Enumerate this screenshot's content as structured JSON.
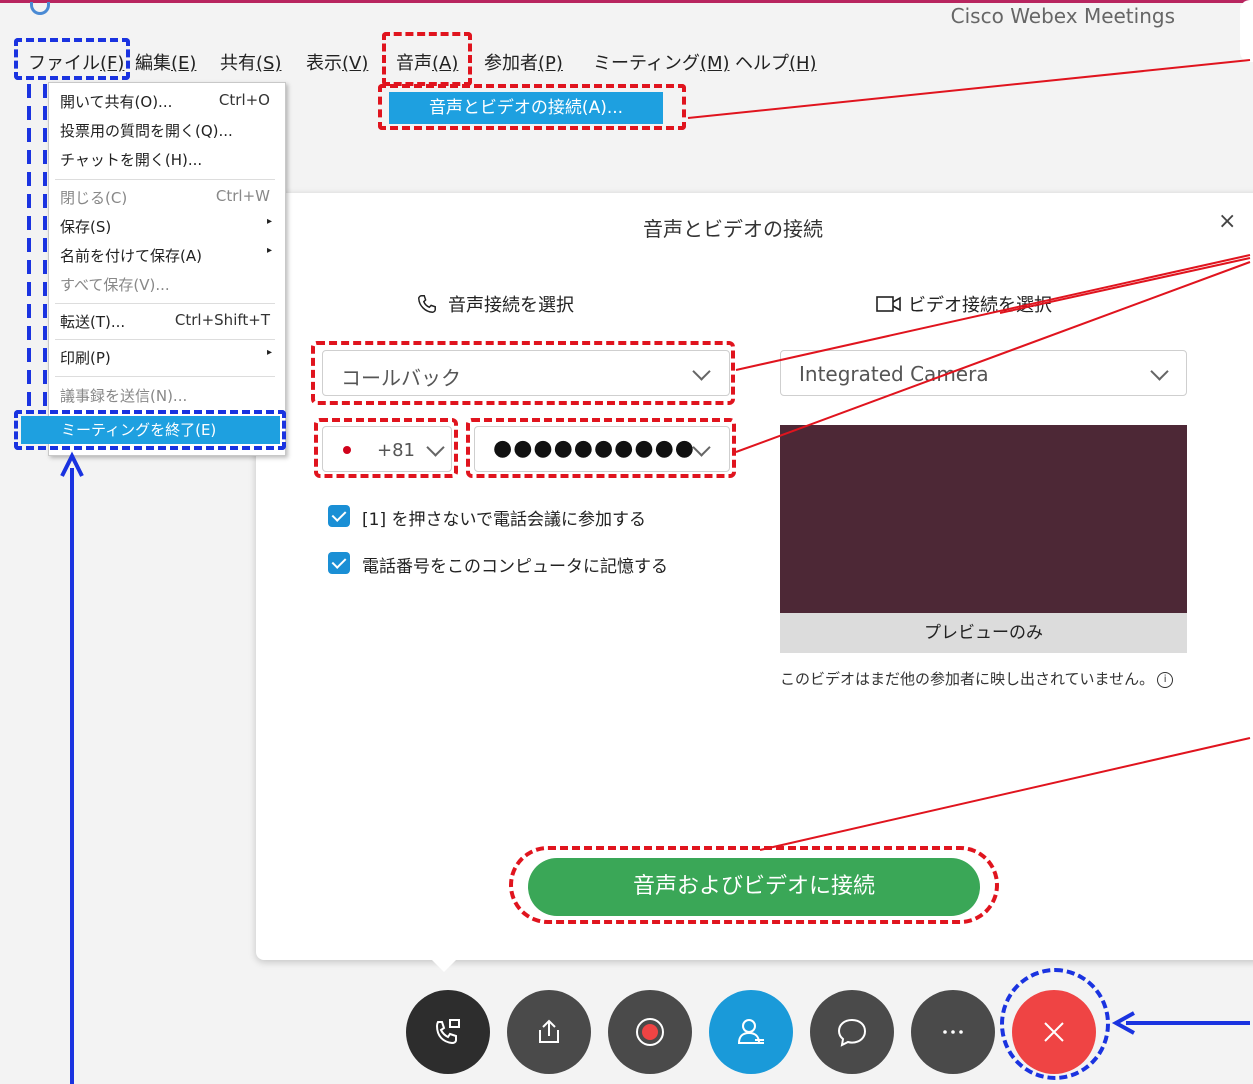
{
  "window": {
    "title": "Cisco Webex Meetings"
  },
  "menubar": {
    "items": [
      {
        "label": "ファイル",
        "accel": "(F)"
      },
      {
        "label": "編集",
        "accel": "(E)"
      },
      {
        "label": "共有",
        "accel": "(S)"
      },
      {
        "label": "表示",
        "accel": "(V)"
      },
      {
        "label": "音声",
        "accel": "(A)"
      },
      {
        "label": "参加者",
        "accel": "(P)"
      },
      {
        "label": "ミーティング",
        "accel": "(M)"
      },
      {
        "label": "ヘルプ",
        "accel": "(H)"
      }
    ]
  },
  "file_menu": {
    "items": [
      {
        "label": "開いて共有(O)...",
        "shortcut": "Ctrl+O"
      },
      {
        "label": "投票用の質問を開く(Q)...",
        "shortcut": ""
      },
      {
        "label": "チャットを開く(H)...",
        "shortcut": ""
      },
      {
        "label": "閉じる(C)",
        "shortcut": "Ctrl+W"
      },
      {
        "label": "保存(S)",
        "shortcut": ""
      },
      {
        "label": "名前を付けて保存(A)",
        "shortcut": ""
      },
      {
        "label": "すべて保存(V)...",
        "shortcut": ""
      },
      {
        "label": "転送(T)...",
        "shortcut": "Ctrl+Shift+T"
      },
      {
        "label": "印刷(P)",
        "shortcut": ""
      },
      {
        "label": "議事録を送信(N)...",
        "shortcut": ""
      },
      {
        "label": "ミーティングを終了(E)",
        "shortcut": ""
      }
    ]
  },
  "audio_menu": {
    "item": "音声とビデオの接続(A)..."
  },
  "dialog": {
    "title": "音声とビデオの接続",
    "close": "×",
    "audio_section_label": "音声接続を選択",
    "video_section_label": "ビデオ接続を選択",
    "audio_select": "コールバック",
    "country_code": "+81",
    "phone_number": "●●●●●●●●●●",
    "checkbox1": "[1] を押さないで電話会議に参加する",
    "checkbox2": "電話番号をこのコンピュータに記憶する",
    "camera_select": "Integrated Camera",
    "preview_label": "プレビューのみ",
    "preview_note": "このビデオはまだ他の参加者に映し出されていません。",
    "connect_button": "音声およびビデオに接続"
  },
  "controls": [
    {
      "name": "audio-call",
      "color": "#2d2d2d"
    },
    {
      "name": "share",
      "color": "#4a4a4a"
    },
    {
      "name": "record",
      "color": "#4a4a4a"
    },
    {
      "name": "participants",
      "color": "#1a9ad9"
    },
    {
      "name": "chat",
      "color": "#4a4a4a"
    },
    {
      "name": "more",
      "color": "#4a4a4a"
    },
    {
      "name": "end",
      "color": "#ef4444"
    }
  ],
  "annotation_colors": {
    "red": "#e0141e",
    "blue": "#1a33e0"
  }
}
